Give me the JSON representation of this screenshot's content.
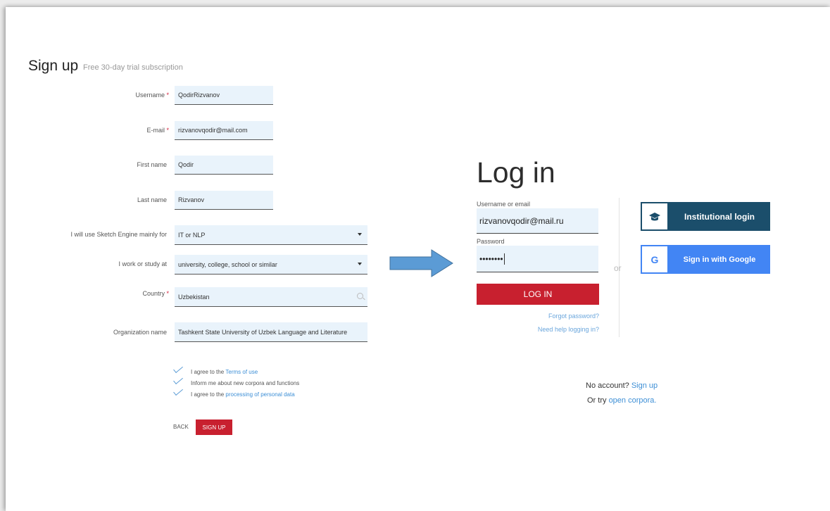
{
  "signup": {
    "title": "Sign up",
    "subtitle": "Free 30-day trial subscription",
    "fields": {
      "username": {
        "label": "Username",
        "required": "*",
        "value": "QodirRizvanov"
      },
      "email": {
        "label": "E-mail",
        "required": "*",
        "value": "rizvanovqodir@mail.com"
      },
      "first_name": {
        "label": "First name",
        "value": "Qodir"
      },
      "last_name": {
        "label": "Last name",
        "value": "Rizvanov"
      },
      "use_for": {
        "label": "I will use Sketch Engine mainly for",
        "value": "IT or NLP"
      },
      "work_study": {
        "label": "I work or study at",
        "value": "university, college, school or similar"
      },
      "country": {
        "label": "Country",
        "required": "*",
        "value": "Uzbekistan"
      },
      "organization": {
        "label": "Organization name",
        "value": "Tashkent State University of Uzbek Language and Literature"
      }
    },
    "checks": {
      "terms_prefix": "I agree to the",
      "terms_link": "Terms of use",
      "inform": "Inform me about new corpora and functions",
      "processing_prefix": "I agree to the",
      "processing_link": "processing of personal data"
    },
    "back_label": "BACK",
    "signup_label": "SIGN UP"
  },
  "login": {
    "title": "Log in",
    "username_label": "Username or email",
    "username_value": "rizvanovqodir@mail.ru",
    "password_label": "Password",
    "password_value": "••••••••",
    "login_button": "LOG IN",
    "forgot": "Forgot password?",
    "help": "Need help logging in?",
    "or": "or",
    "institutional": "Institutional login",
    "google": "Sign in with Google",
    "no_account": "No account?",
    "sign_up_link": "Sign up",
    "or_try": "Or try",
    "open_corpora": "open corpora."
  },
  "colors": {
    "accent_red": "#c8202f",
    "institutional_blue": "#1b4e6b",
    "google_blue": "#4285f4",
    "link_blue": "#3d8fd6"
  },
  "icons": {
    "institutional": "graduation-cap-icon",
    "google": "google-g-icon",
    "country_search": "search-icon",
    "dropdown": "chevron-down-icon",
    "checkbox": "checkmark-icon",
    "flow": "arrow-right-icon"
  }
}
